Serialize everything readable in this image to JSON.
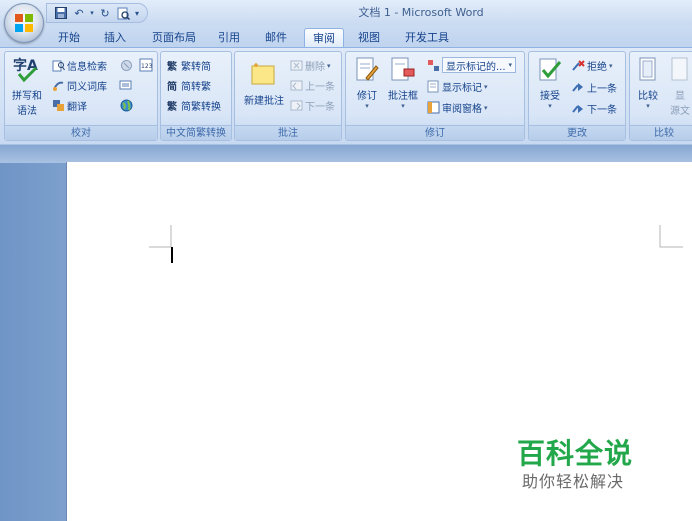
{
  "window": {
    "title": "文档 1 - Microsoft Word"
  },
  "quick_access": [
    "save-icon",
    "undo-icon",
    "redo-icon",
    "print-preview-icon"
  ],
  "tabs": [
    {
      "label": "开始",
      "active": false
    },
    {
      "label": "插入",
      "active": false
    },
    {
      "label": "页面布局",
      "active": false
    },
    {
      "label": "引用",
      "active": false
    },
    {
      "label": "邮件",
      "active": false
    },
    {
      "label": "审阅",
      "active": true
    },
    {
      "label": "视图",
      "active": false
    },
    {
      "label": "开发工具",
      "active": false
    }
  ],
  "ribbon": {
    "proofing": {
      "label": "校对",
      "spelling_line1": "拼写和",
      "spelling_line2": "语法",
      "research": "信息检索",
      "thesaurus": "同义词库",
      "translate": "翻译"
    },
    "chinese_conversion": {
      "label": "中文简繁转换",
      "to_simplified": "繁转简",
      "to_traditional": "简转繁",
      "convert": "简繁转换"
    },
    "comments": {
      "label": "批注",
      "new_comment": "新建批注",
      "delete": "删除",
      "previous": "上一条",
      "next": "下一条"
    },
    "tracking": {
      "label": "修订",
      "track_changes": "修订",
      "balloons": "批注框",
      "display_for_review": "显示标记的...",
      "show_markup": "显示标记",
      "reviewing_pane": "审阅窗格"
    },
    "changes": {
      "label": "更改",
      "accept": "接受",
      "reject": "拒绝",
      "previous": "上一条",
      "next": "下一条"
    },
    "compare": {
      "label": "比较",
      "compare": "比较",
      "show_source_line1": "显",
      "show_source_line2": "源文"
    }
  },
  "watermark": {
    "title": "百科全说",
    "subtitle": "助你轻松解决"
  },
  "colors": {
    "ribbon_text": "#15428b",
    "watermark_green": "#22a84b"
  }
}
